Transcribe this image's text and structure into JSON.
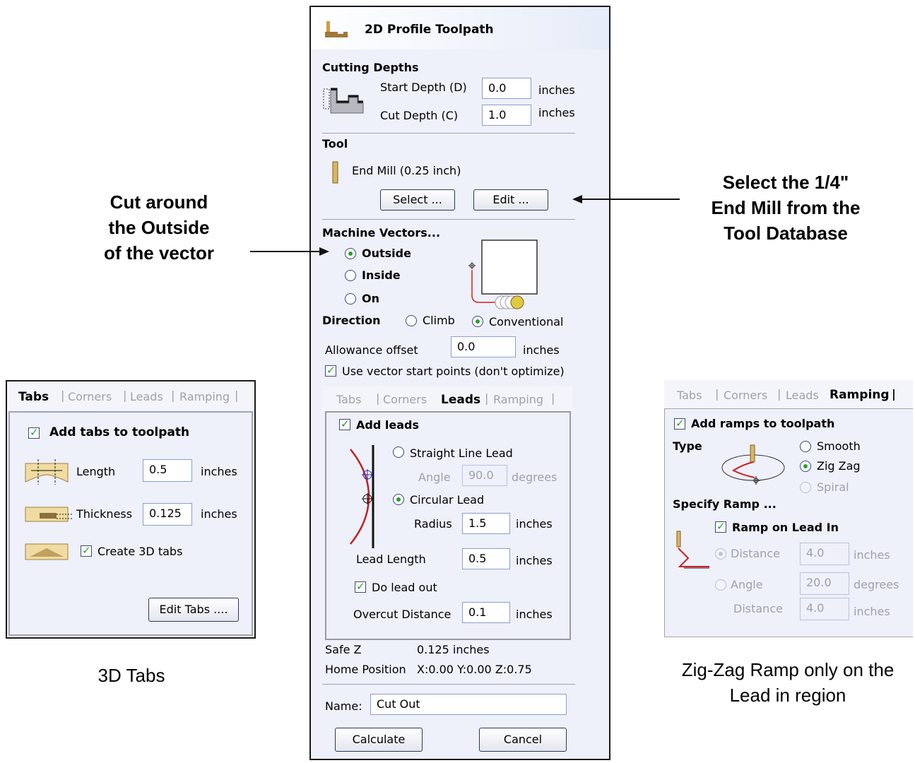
{
  "main_panel": {
    "title": "2D Profile Toolpath",
    "cutting_depths": {
      "heading": "Cutting Depths",
      "start_label": "Start Depth (D)",
      "start_value": "0.0",
      "cut_label": "Cut Depth (C)",
      "cut_value": "1.0",
      "unit": "inches"
    },
    "tool": {
      "heading": "Tool",
      "name": "End Mill (0.25 inch)",
      "select_label": "Select ...",
      "edit_label": "Edit ..."
    },
    "machine_vectors": {
      "heading": "Machine Vectors...",
      "outside": "Outside",
      "inside": "Inside",
      "on": "On",
      "selected": "Outside",
      "direction_label": "Direction",
      "climb": "Climb",
      "conventional": "Conventional",
      "direction_selected": "Conventional"
    },
    "allowance": {
      "label": "Allowance offset",
      "value": "0.0",
      "unit": "inches"
    },
    "use_start_points": {
      "label": "Use vector start points (don't optimize)",
      "checked": true
    },
    "tabs": [
      "Tabs",
      "Corners",
      "Leads",
      "Ramping"
    ],
    "active_tab": "Leads",
    "leads": {
      "add_label": "Add leads",
      "straight": "Straight Line Lead",
      "angle_label": "Angle",
      "angle_value": "90.0",
      "angle_unit": "degrees",
      "circular": "Circular Lead",
      "radius_label": "Radius",
      "radius_value": "1.5",
      "length_label": "Lead Length",
      "length_value": "0.5",
      "unit": "inches",
      "lead_out_label": "Do lead out",
      "overcut_label": "Overcut Distance",
      "overcut_value": "0.1"
    },
    "safe_z": {
      "label": "Safe Z",
      "value": "0.125 inches"
    },
    "home": {
      "label": "Home Position",
      "value": "X:0.00 Y:0.00 Z:0.75"
    },
    "name": {
      "label": "Name:",
      "value": "Cut Out"
    },
    "calculate_label": "Calculate",
    "cancel_label": "Cancel"
  },
  "tabs_panel": {
    "tabs": [
      "Tabs",
      "Corners",
      "Leads",
      "Ramping"
    ],
    "active_tab": "Tabs",
    "add_label": "Add tabs to toolpath",
    "length_label": "Length",
    "length_value": "0.5",
    "thickness_label": "Thickness",
    "thickness_value": "0.125",
    "unit": "inches",
    "create3d_label": "Create 3D tabs",
    "edit_label": "Edit Tabs ...."
  },
  "ramping_panel": {
    "tabs": [
      "Tabs",
      "Corners",
      "Leads",
      "Ramping"
    ],
    "active_tab": "Ramping",
    "add_label": "Add ramps to toolpath",
    "type_label": "Type",
    "smooth": "Smooth",
    "zigzag": "Zig Zag",
    "spiral": "Spiral",
    "specify_label": "Specify Ramp ...",
    "ramp_lead_in": "Ramp on Lead In",
    "distance_label": "Distance",
    "distance_value": "4.0",
    "angle_label": "Angle",
    "angle_value": "20.0",
    "distance2_label": "Distance",
    "distance2_value": "4.0",
    "unit_inches": "inches",
    "unit_degrees": "degrees"
  },
  "annotations": {
    "left_line1": "Cut around",
    "left_line2": "the Outside",
    "left_line3": "of the vector",
    "right_line1": "Select the 1/4\"",
    "right_line2": "End Mill from the",
    "right_line3": "Tool Database",
    "tabs_caption": "3D Tabs",
    "ramp_caption1": "Zig-Zag Ramp only on the",
    "ramp_caption2": "Lead in region"
  }
}
